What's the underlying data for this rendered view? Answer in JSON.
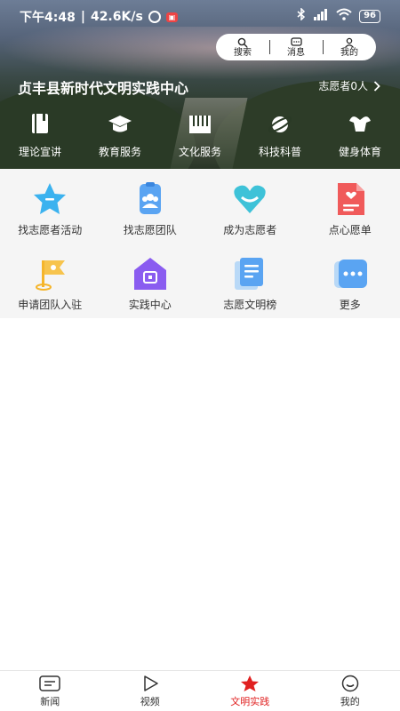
{
  "status_bar": {
    "time": "下午4:48",
    "network_speed": "42.6K/s",
    "battery": "96"
  },
  "top_actions": [
    {
      "label": "搜索",
      "icon": "search-icon"
    },
    {
      "label": "消息",
      "icon": "message-icon"
    },
    {
      "label": "我的",
      "icon": "user-icon"
    }
  ],
  "hero": {
    "title": "贞丰县新时代文明实践中心",
    "volunteer_count": "志愿者0人",
    "nav": [
      {
        "label": "理论宣讲",
        "icon": "book-icon"
      },
      {
        "label": "教育服务",
        "icon": "graduation-cap-icon"
      },
      {
        "label": "文化服务",
        "icon": "piano-icon"
      },
      {
        "label": "科技科普",
        "icon": "planet-icon"
      },
      {
        "label": "健身体育",
        "icon": "muscle-icon"
      }
    ]
  },
  "services": [
    {
      "label": "找志愿者活动",
      "icon": "star-icon"
    },
    {
      "label": "找志愿团队",
      "icon": "team-icon"
    },
    {
      "label": "成为志愿者",
      "icon": "heart-icon"
    },
    {
      "label": "点心愿单",
      "icon": "wish-list-icon"
    },
    {
      "label": "申请团队入驻",
      "icon": "flag-icon"
    },
    {
      "label": "实践中心",
      "icon": "house-icon"
    },
    {
      "label": "志愿文明榜",
      "icon": "document-icon"
    },
    {
      "label": "更多",
      "icon": "more-icon"
    }
  ],
  "tabs": [
    {
      "label": "新闻",
      "icon": "news-icon"
    },
    {
      "label": "视频",
      "icon": "play-icon"
    },
    {
      "label": "文明实践",
      "icon": "star-tab-icon",
      "active": true
    },
    {
      "label": "我的",
      "icon": "smile-icon"
    }
  ],
  "colors": {
    "accent": "#e02020",
    "grid_bg": "#f5f5f5"
  }
}
